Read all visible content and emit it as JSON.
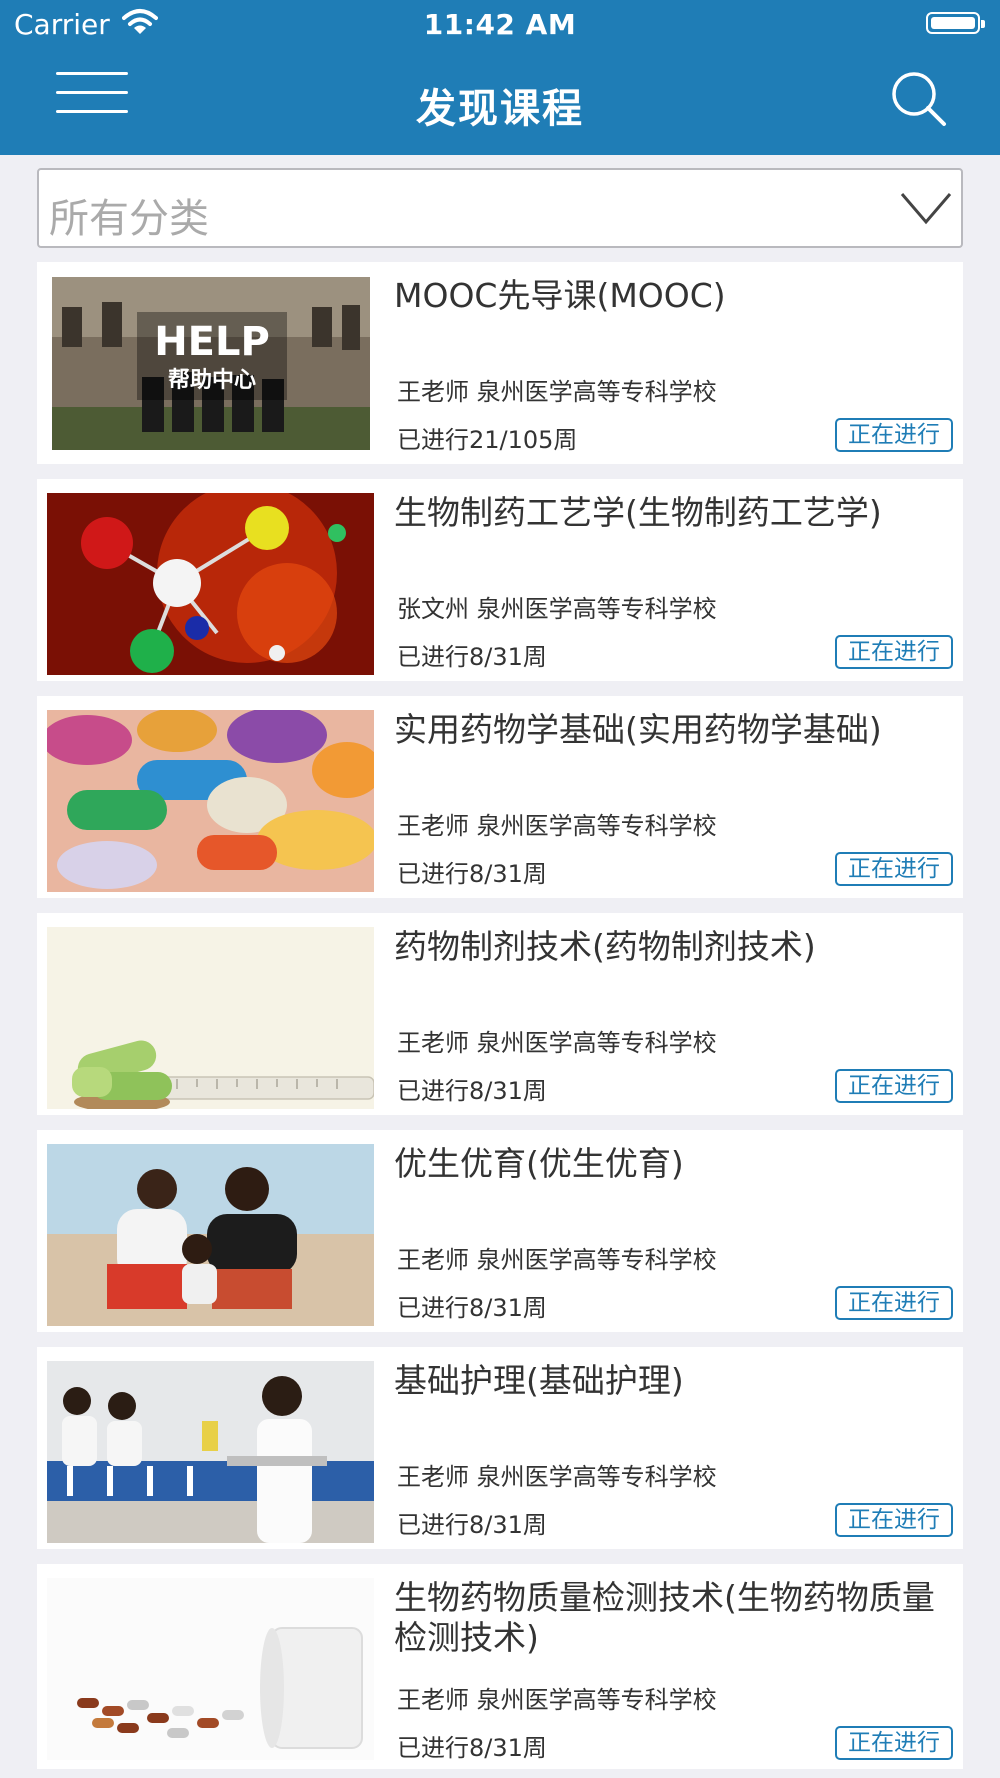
{
  "status_bar": {
    "carrier": "Carrier",
    "time": "11:42 AM"
  },
  "nav": {
    "title": "发现课程"
  },
  "filter": {
    "label": "所有分类"
  },
  "thumb_text": {
    "help_big": "HELP",
    "help_small": "帮助中心"
  },
  "courses": [
    {
      "title": "MOOC先导课(MOOC)",
      "teacher": "王老师 泉州医学高等专科学校",
      "progress": "已进行21/105周",
      "status": "正在进行"
    },
    {
      "title": "生物制药工艺学(生物制药工艺学)",
      "teacher": "张文州 泉州医学高等专科学校",
      "progress": "已进行8/31周",
      "status": "正在进行"
    },
    {
      "title": "实用药物学基础(实用药物学基础)",
      "teacher": "王老师 泉州医学高等专科学校",
      "progress": "已进行8/31周",
      "status": "正在进行"
    },
    {
      "title": "药物制剂技术(药物制剂技术)",
      "teacher": "王老师 泉州医学高等专科学校",
      "progress": "已进行8/31周",
      "status": "正在进行"
    },
    {
      "title": "优生优育(优生优育)",
      "teacher": "王老师 泉州医学高等专科学校",
      "progress": "已进行8/31周",
      "status": "正在进行"
    },
    {
      "title": "基础护理(基础护理)",
      "teacher": "王老师 泉州医学高等专科学校",
      "progress": "已进行8/31周",
      "status": "正在进行"
    },
    {
      "title": "生物药物质量检测技术(生物药物质量检测技术)",
      "teacher": "王老师 泉州医学高等专科学校",
      "progress": "已进行8/31周",
      "status": "正在进行"
    }
  ],
  "colors": {
    "brand": "#1f7db6",
    "background": "#efeff4"
  }
}
